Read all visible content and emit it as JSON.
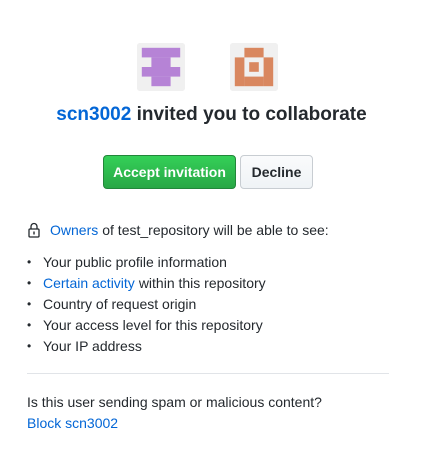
{
  "invite": {
    "inviter_username": "scn3002",
    "headline_rest": "invited you to collaborate",
    "accept_label": "Accept invitation",
    "decline_label": "Decline"
  },
  "avatars": {
    "inviter_icon": "identicon-purple",
    "inviter_color": "#b683d6",
    "user_icon": "identicon-orange",
    "user_color": "#d9875f"
  },
  "permissions": {
    "owners_link": "Owners",
    "owners_rest": "of test_repository will be able to see:",
    "items": [
      {
        "link": "",
        "text": "Your public profile information"
      },
      {
        "link": "Certain activity",
        "text": "within this repository"
      },
      {
        "link": "",
        "text": "Country of request origin"
      },
      {
        "link": "",
        "text": "Your access level for this repository"
      },
      {
        "link": "",
        "text": "Your IP address"
      }
    ]
  },
  "spam": {
    "question": "Is this user sending spam or malicious content?",
    "block_label": "Block scn3002"
  },
  "colors": {
    "link": "#0366d6",
    "accept_bg": "#28a745",
    "text": "#24292e"
  }
}
